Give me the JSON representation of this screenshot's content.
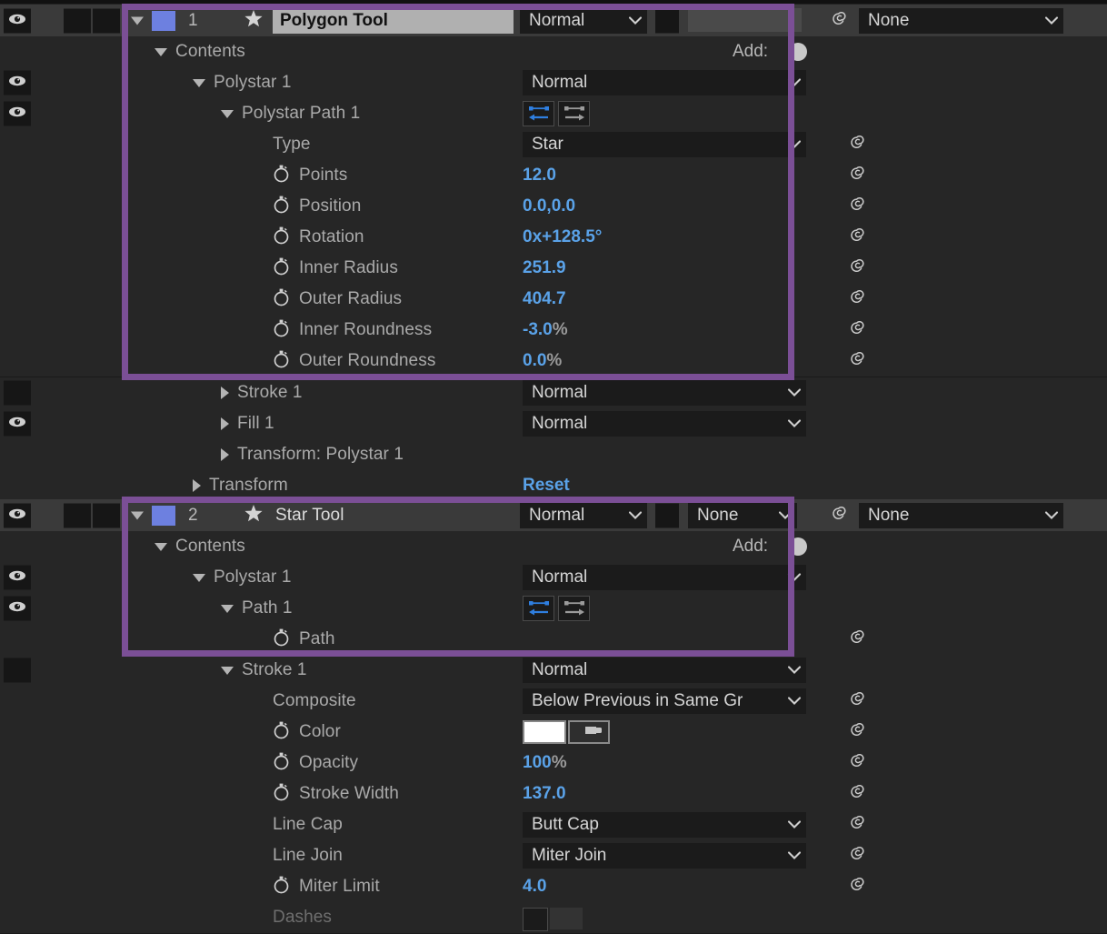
{
  "app": {
    "panel_name": "timeline-layer-panel",
    "accent_highlight_color": "#7b4f96",
    "value_color": "#5aa2e8",
    "layer_color_swatch": "#6d80e0"
  },
  "columns": {
    "blend_mode_default": "Normal",
    "track_matte_none": "None",
    "parent_none": "None",
    "add_label": "Add:"
  },
  "rows": [
    {
      "id": "r0",
      "kind": "layer-header",
      "indent": 0,
      "num": "1",
      "name": "Polygon Tool",
      "icon": "star-icon",
      "mode": "Normal",
      "matte": "",
      "parent": "None",
      "eye": "header"
    },
    {
      "id": "r1",
      "kind": "group",
      "indent": 1,
      "label": "Contents",
      "tri": "down",
      "add": "Add:"
    },
    {
      "id": "r2",
      "kind": "group",
      "indent": 2,
      "label": "Polystar 1",
      "tri": "down",
      "mode": "Normal",
      "eye": true
    },
    {
      "id": "r3",
      "kind": "group",
      "indent": 3,
      "label": "Polystar Path 1",
      "tri": "down",
      "pathbuttons": true,
      "eye": true
    },
    {
      "id": "r4",
      "kind": "dropdown-prop",
      "indent": 4,
      "label": "Type",
      "value": "Star",
      "spiral": true
    },
    {
      "id": "r5",
      "kind": "prop",
      "indent": 4,
      "label": "Points",
      "value": "12.0",
      "unit": "",
      "stopwatch": true,
      "spiral": true
    },
    {
      "id": "r6",
      "kind": "prop",
      "indent": 4,
      "label": "Position",
      "value": "0.0,0.0",
      "unit": "",
      "stopwatch": true,
      "spiral": true
    },
    {
      "id": "r7",
      "kind": "prop",
      "indent": 4,
      "label": "Rotation",
      "value": "0x+128.5°",
      "unit": "",
      "stopwatch": true,
      "spiral": true
    },
    {
      "id": "r8",
      "kind": "prop",
      "indent": 4,
      "label": "Inner Radius",
      "value": "251.9",
      "unit": "",
      "stopwatch": true,
      "spiral": true
    },
    {
      "id": "r9",
      "kind": "prop",
      "indent": 4,
      "label": "Outer Radius",
      "value": "404.7",
      "unit": "",
      "stopwatch": true,
      "spiral": true
    },
    {
      "id": "r10",
      "kind": "prop",
      "indent": 4,
      "label": "Inner Roundness",
      "value": "-3.0",
      "unit": "%",
      "stopwatch": true,
      "spiral": true
    },
    {
      "id": "r11",
      "kind": "prop",
      "indent": 4,
      "label": "Outer Roundness",
      "value": "0.0",
      "unit": "%",
      "stopwatch": true,
      "spiral": true
    },
    {
      "id": "r12",
      "kind": "group",
      "indent": 3,
      "label": "Stroke 1",
      "tri": "right",
      "mode": "Normal",
      "eye": false
    },
    {
      "id": "r13",
      "kind": "group",
      "indent": 3,
      "label": "Fill 1",
      "tri": "right",
      "mode": "Normal",
      "eye": true
    },
    {
      "id": "r14",
      "kind": "group",
      "indent": 3,
      "label": "Transform: Polystar 1",
      "tri": "right"
    },
    {
      "id": "r15",
      "kind": "group-reset",
      "indent": 2,
      "label": "Transform",
      "tri": "right",
      "value": "Reset"
    },
    {
      "id": "r16",
      "kind": "layer-header",
      "indent": 0,
      "num": "2",
      "name": "Star Tool",
      "icon": "star-icon",
      "mode": "Normal",
      "matte": "None",
      "parent": "None",
      "eye": "on"
    },
    {
      "id": "r17",
      "kind": "group",
      "indent": 1,
      "label": "Contents",
      "tri": "down",
      "add": "Add:"
    },
    {
      "id": "r18",
      "kind": "group",
      "indent": 2,
      "label": "Polystar 1",
      "tri": "down",
      "mode": "Normal",
      "eye": true
    },
    {
      "id": "r19",
      "kind": "group",
      "indent": 3,
      "label": "Path 1",
      "tri": "down",
      "pathbuttons": true,
      "eye": true
    },
    {
      "id": "r20",
      "kind": "prop",
      "indent": 4,
      "label": "Path",
      "value": "",
      "unit": "",
      "stopwatch": true,
      "spiral": true
    },
    {
      "id": "r21",
      "kind": "group",
      "indent": 3,
      "label": "Stroke 1",
      "tri": "down",
      "mode": "Normal",
      "eye": false
    },
    {
      "id": "r22",
      "kind": "dropdown-prop",
      "indent": 4,
      "label": "Composite",
      "value": "Below Previous in Same Gr",
      "spiral": true
    },
    {
      "id": "r23",
      "kind": "color-prop",
      "indent": 4,
      "label": "Color",
      "stopwatch": true,
      "spiral": true,
      "swatch_color": "#ffffff"
    },
    {
      "id": "r24",
      "kind": "prop",
      "indent": 4,
      "label": "Opacity",
      "value": "100",
      "unit": "%",
      "stopwatch": true,
      "spiral": true
    },
    {
      "id": "r25",
      "kind": "prop",
      "indent": 4,
      "label": "Stroke Width",
      "value": "137.0",
      "unit": "",
      "stopwatch": true,
      "spiral": true
    },
    {
      "id": "r26",
      "kind": "dropdown-prop",
      "indent": 4,
      "label": "Line Cap",
      "value": "Butt Cap",
      "spiral": true
    },
    {
      "id": "r27",
      "kind": "dropdown-prop",
      "indent": 4,
      "label": "Line Join",
      "value": "Miter Join",
      "spiral": true
    },
    {
      "id": "r28",
      "kind": "prop",
      "indent": 4,
      "label": "Miter Limit",
      "value": "4.0",
      "unit": "",
      "stopwatch": true,
      "spiral": true
    },
    {
      "id": "r29",
      "kind": "clipped",
      "indent": 4,
      "label": "Dashes"
    }
  ]
}
